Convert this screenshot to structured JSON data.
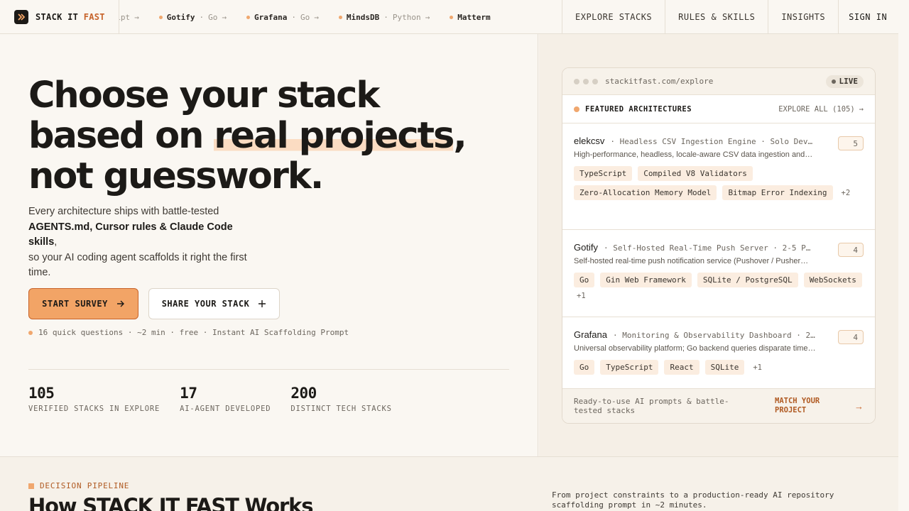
{
  "brand": {
    "name_prefix": "STACK IT ",
    "name_accent": "FAST"
  },
  "ticker": [
    {
      "name": "",
      "lang": "cript"
    },
    {
      "name": "Gotify",
      "lang": "Go"
    },
    {
      "name": "Grafana",
      "lang": "Go"
    },
    {
      "name": "MindsDB",
      "lang": "Python"
    },
    {
      "name": "Matterm",
      "lang": ""
    }
  ],
  "nav": {
    "explore": "EXPLORE STACKS",
    "rules": "RULES & SKILLS",
    "insights": "INSIGHTS",
    "signin": "SIGN IN"
  },
  "hero": {
    "line1": "Choose your stack",
    "line2_pre": "based on ",
    "line2_hl": "real projects",
    "line2_post": ",",
    "line3": "not guesswork.",
    "sub_1": "Every architecture ships with battle-tested",
    "sub_bold": "AGENTS.md, Cursor rules & Claude Code skills",
    "sub_2": "so your AI coding agent scaffolds it right the first time.",
    "cta_primary": "START SURVEY",
    "cta_secondary": "SHARE YOUR STACK",
    "meta": "16 quick questions · ~2 min · free · Instant AI Scaffolding Prompt"
  },
  "stats": [
    {
      "value": "105",
      "label": "VERIFIED STACKS IN EXPLORE"
    },
    {
      "value": "17",
      "label": "AI-AGENT DEVELOPED"
    },
    {
      "value": "200",
      "label": "DISTINCT TECH STACKS"
    }
  ],
  "card": {
    "url": "stackitfast.com/explore",
    "live": "LIVE",
    "heading": "FEATURED ARCHITECTURES",
    "explore_all": "EXPLORE ALL (105)",
    "projects": [
      {
        "name": "elekcsv",
        "info": "· Headless CSV Ingestion Engine · Solo Dev…",
        "count": "5",
        "desc": "High-performance, headless, locale-aware CSV data ingestion and…",
        "tags": [
          "TypeScript",
          "Compiled V8 Validators",
          "Zero-Allocation Memory Model",
          "Bitmap Error Indexing"
        ],
        "more": "+2"
      },
      {
        "name": "Gotify",
        "info": "· Self-Hosted Real-Time Push Server · 2-5 P…",
        "count": "4",
        "desc": "Self-hosted real-time push notification service (Pushover / Pusher…",
        "tags": [
          "Go",
          "Gin Web Framework",
          "SQLite / PostgreSQL",
          "WebSockets"
        ],
        "more": "+1"
      },
      {
        "name": "Grafana",
        "info": "· Monitoring & Observability Dashboard · 2…",
        "count": "4",
        "desc": "Universal observability platform; Go backend queries disparate time…",
        "tags": [
          "Go",
          "TypeScript",
          "React",
          "SQLite"
        ],
        "more": "+1"
      }
    ],
    "footer_text": "Ready-to-use AI prompts & battle-tested stacks",
    "footer_cta": "MATCH YOUR PROJECT"
  },
  "pipeline": {
    "label": "DECISION PIPELINE",
    "title": "How STACK IT FAST Works",
    "desc": "From project constraints to a production-ready AI repository scaffolding prompt in ~2 minutes."
  },
  "icons": {
    "logo": "chevron-logo-icon",
    "arrow": "arrow-right-icon",
    "plus": "plus-icon"
  },
  "colors": {
    "accent": "#f2a466",
    "accent_dark": "#c7632a",
    "background": "#faf7f2"
  }
}
